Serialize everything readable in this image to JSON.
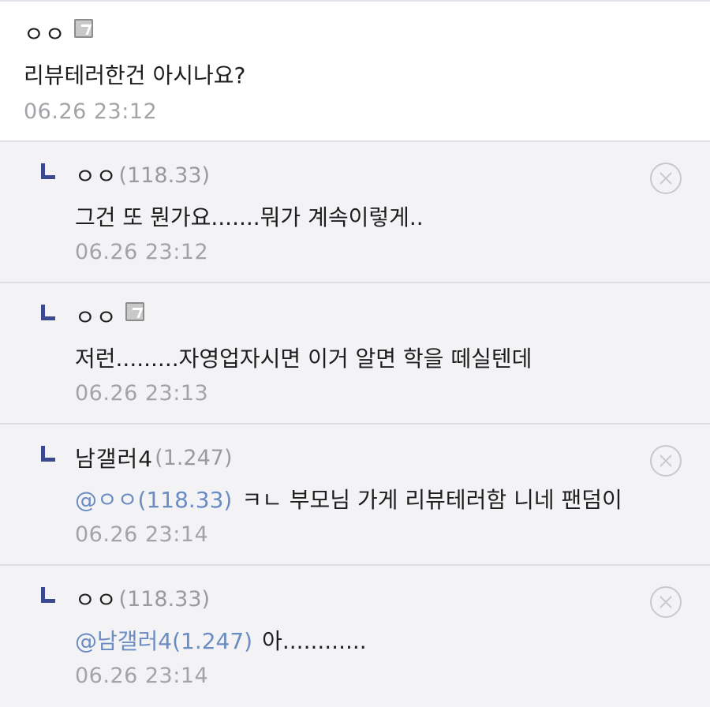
{
  "main_comment": {
    "nick": "ㅇㅇ",
    "content": "리뷰테러한건 아시나요?",
    "date": "06.26 23:12"
  },
  "replies": [
    {
      "nick": "ㅇㅇ",
      "ip": "(118.33)",
      "mention": "",
      "content": "그건 또 뭔가요.......뭐가 계속이렇게..",
      "date": "06.26 23:12",
      "deletable": true,
      "fixed": false
    },
    {
      "nick": "ㅇㅇ",
      "ip": "",
      "mention": "",
      "content": "저런.........자영업자시면 이거 알면 학을 떼실텐데",
      "date": "06.26 23:13",
      "deletable": false,
      "fixed": true
    },
    {
      "nick": "남갤러4",
      "ip": "(1.247)",
      "mention": "@ㅇㅇ(118.33)",
      "content": "ㅋㄴ 부모님 가게 리뷰테러함 니네 팬덤이",
      "date": "06.26 23:14",
      "deletable": true,
      "fixed": false
    },
    {
      "nick": "ㅇㅇ",
      "ip": "(118.33)",
      "mention": "@남갤러4(1.247)",
      "content": "아............",
      "date": "06.26 23:14",
      "deletable": true,
      "fixed": false
    }
  ],
  "icons": {
    "reply": "reply-arrow-icon",
    "fixed_nick": "fixed-nick-badge-icon",
    "delete": "delete-circle-x-icon"
  },
  "colors": {
    "mention": "#6a8cc2",
    "reply_arrow": "#3b4a8e",
    "reply_bg": "#f3f3f6"
  }
}
